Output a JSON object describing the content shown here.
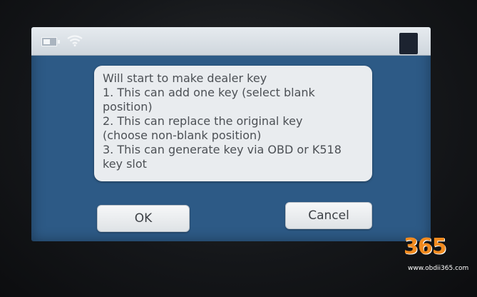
{
  "dialog": {
    "lines": [
      "Will start to make dealer key",
      "1. This can add one key (select blank",
      "position)",
      "2. This can replace the original key",
      "(choose non-blank position)",
      "3. This can generate key via OBD or K518",
      "key slot"
    ],
    "ok_label": "OK",
    "cancel_label": "Cancel"
  },
  "watermark": {
    "logo": "365",
    "url": "www.obdii365.com"
  },
  "colors": {
    "screen_bg": "#2d5a86",
    "dialog_bg": "#e9ecef",
    "logo_orange": "#f18a1e"
  },
  "icons": [
    "battery-icon",
    "wifi-icon"
  ]
}
